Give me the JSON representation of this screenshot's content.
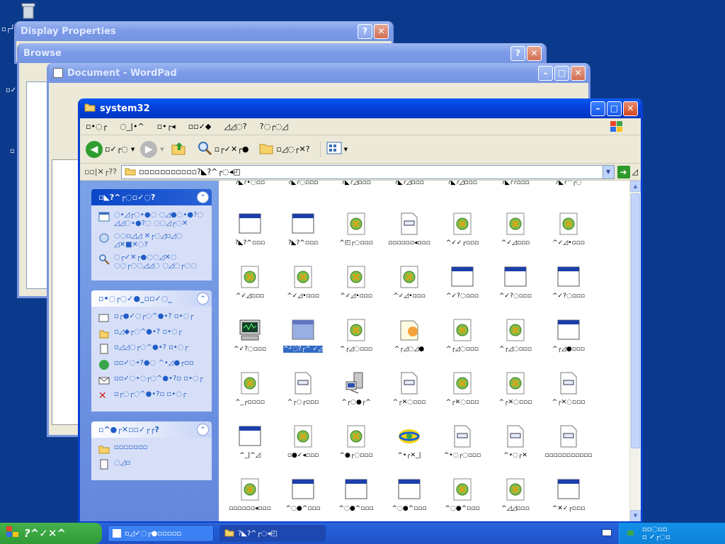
{
  "desktop": {
    "label_top": "▫┌┘",
    "label_mid": "▫ ▾",
    "label_bot": "▫✓"
  },
  "windows": {
    "display_properties": "Display Properties",
    "browse": "Browse",
    "wordpad": "Document - WordPad",
    "explorer": "system32"
  },
  "explorer": {
    "menu": [
      "▫•◌┌",
      "◌_|•^",
      "▫•┌◂",
      "▫▫✓◆",
      "◿◿◌?",
      "?◌┌◌◿"
    ],
    "back_label": "▫✓┌◌",
    "search_label": "▫┌✓✕┌●",
    "folders_label": "▫◿◌┌✕?",
    "address_label": "▫▫|✕┌??",
    "address_value": "▫▫▫▫▫▫▫▫▫▫▫?◣?^┌◌◂◰",
    "go_label": "◿",
    "pane_groups": [
      {
        "title": "▫◣?^┌◌▫✓◌?",
        "items": [
          "◌•◿┌◌•●◌ ◌◿●◌•●?◌ ◿◿◌•●?◌ ◌◌◿┌◌✕",
          "◌◌▫◿◿ ✕┌◌◿▫◿◌ ◿✕■✕◌?",
          "◌┌✓✕┌●◌◌◿✕◌ ◌◌┌◌◌◿◿◌ ◌◿◌┌◌◌"
        ]
      },
      {
        "title": "▫•◌┌◌✓●_▫▫✓◌_",
        "items": [
          "▫┌●✓◌┌◌^●•? ▫•◌┌",
          "▫◿◆┌◌^●•? ▫•◌┌",
          "▫◿◿◌┌◌^●•? ▫•◌┌",
          "▫▫✓◌•?●◌ ^•◿●┌▫▫",
          "▫▫✓◌•◌┌◌^●•?▫ ▫•◌┌",
          "▫┌◌┌◌^●•?▫ ▫•◌┌"
        ]
      },
      {
        "title": "▫^●┌✕▫▫✓┌┌?",
        "items": [
          "▫▫▫▫▫▫▫",
          "◌◿▫"
        ]
      }
    ],
    "files": [
      [
        "?◣?•◌▫▫",
        "?◣?◌▫▫▫",
        "?◣?◿▫▫▫",
        "?◣?◿▫▫▫",
        "?◣?◿▫▫▫",
        "?◣??▫▫▫",
        "?◣?^┌◌"
      ],
      [
        "?◣?^▫▫▫",
        "?◣?^▫▫▫",
        "^◰┌◌▫▫▫",
        "▫▫▫▫▫▫◂▫▫▫",
        "^✓✓┌▫▫▫",
        "^✓◿▫▫▫",
        "^✓◿•▫▫▫"
      ],
      [
        "^✓◿▫▫▫",
        "^✓◿•▫▫▫",
        "^✓◿•▫▫▫",
        "^✓◿•▫▫▫",
        "^✓?◌▫▫▫",
        "^✓?◌▫▫▫",
        "^✓?◌▫▫▫"
      ],
      [
        "^✓?◌▫▫▫",
        "^┘◌?┌^ ✓◿",
        "^┌◿◌▫▫▫",
        "^┌◿◌◿●",
        "^┌◿◌▫▫▫",
        "^┌◿◌▫▫▫",
        "^┌◿●▫▫▫"
      ],
      [
        "^_┌▫▫▫▫",
        "^┌◌┌▫▫▫",
        "^┌◌●┌^",
        "^┌✕◌▫▫▫",
        "^┌✕◌▫▫▫",
        "^┌✕◌▫▫▫",
        "^┌✕◌▫▫▫"
      ],
      [
        "^_|^◿",
        "▫●✓◂▫▫▫",
        "^●┌◌▫▫▫",
        "^•┌✕_|",
        "^•◌┌◌▫▫▫",
        "^•◌┌✕",
        "▫▫▫▫▫▫▫▫▫▫▫"
      ],
      [
        "▫▫▫▫▫▫◂▫▫▫",
        "^◌●^▫▫▫",
        "^◌●^▫▫▫",
        "^◌●^▫▫▫",
        "^◌●^▫▫▫",
        "^◿◿▫▫▫",
        "^✕✓┌▫▫▫"
      ]
    ],
    "file_types": [
      [
        "app",
        "app",
        "app",
        "app",
        "app",
        "app",
        "app"
      ],
      [
        "win",
        "win",
        "set",
        "doc",
        "set",
        "set",
        "set"
      ],
      [
        "set",
        "set",
        "set",
        "set",
        "win",
        "win",
        "win"
      ],
      [
        "mon",
        "sel",
        "set",
        "note",
        "set",
        "set",
        "win"
      ],
      [
        "set",
        "doc",
        "net",
        "doc",
        "set",
        "set",
        "doc"
      ],
      [
        "win",
        "set",
        "set",
        "globe",
        "doc",
        "doc",
        "doc"
      ],
      [
        "set",
        "win",
        "win",
        "win",
        "set",
        "set",
        "win"
      ]
    ],
    "selected": "3-1"
  },
  "taskbar": {
    "start_label": "?^✓✕^",
    "tasks": [
      "▫◿✓◌┌●▫▫▫▫▫",
      "?◣?^┌◌◂◰"
    ],
    "tray_text": "▫▫◌▫▫",
    "tray_sub": "▫ ✓┌◌▫"
  }
}
